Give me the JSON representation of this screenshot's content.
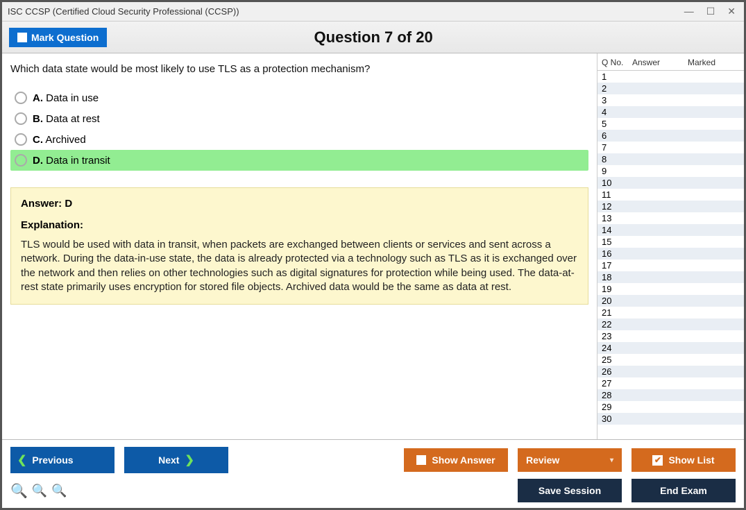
{
  "title": "ISC CCSP (Certified Cloud Security Professional (CCSP))",
  "toolbar": {
    "mark_label": "Mark Question",
    "question_title": "Question 7 of 20"
  },
  "question": {
    "text": "Which data state would be most likely to use TLS as a protection mechanism?",
    "options": [
      {
        "letter": "A.",
        "text": "Data in use",
        "correct": false
      },
      {
        "letter": "B.",
        "text": "Data at rest",
        "correct": false
      },
      {
        "letter": "C.",
        "text": "Archived",
        "correct": false
      },
      {
        "letter": "D.",
        "text": "Data in transit",
        "correct": true
      }
    ],
    "answer_line": "Answer: D",
    "explanation_label": "Explanation:",
    "explanation_text": "TLS would be used with data in transit, when packets are exchanged between clients or services and sent across a network. During the data-in-use state, the data is already protected via a technology such as TLS as it is exchanged over the network and then relies on other technologies such as digital signatures for protection while being used. The data-at-rest state primarily uses encryption for stored file objects. Archived data would be the same as data at rest."
  },
  "side": {
    "headers": {
      "qno": "Q No.",
      "answer": "Answer",
      "marked": "Marked"
    },
    "rows": [
      "1",
      "2",
      "3",
      "4",
      "5",
      "6",
      "7",
      "8",
      "9",
      "10",
      "11",
      "12",
      "13",
      "14",
      "15",
      "16",
      "17",
      "18",
      "19",
      "20",
      "21",
      "22",
      "23",
      "24",
      "25",
      "26",
      "27",
      "28",
      "29",
      "30"
    ]
  },
  "footer": {
    "previous": "Previous",
    "next": "Next",
    "show_answer": "Show Answer",
    "review": "Review",
    "show_list": "Show List",
    "save_session": "Save Session",
    "end_exam": "End Exam"
  }
}
